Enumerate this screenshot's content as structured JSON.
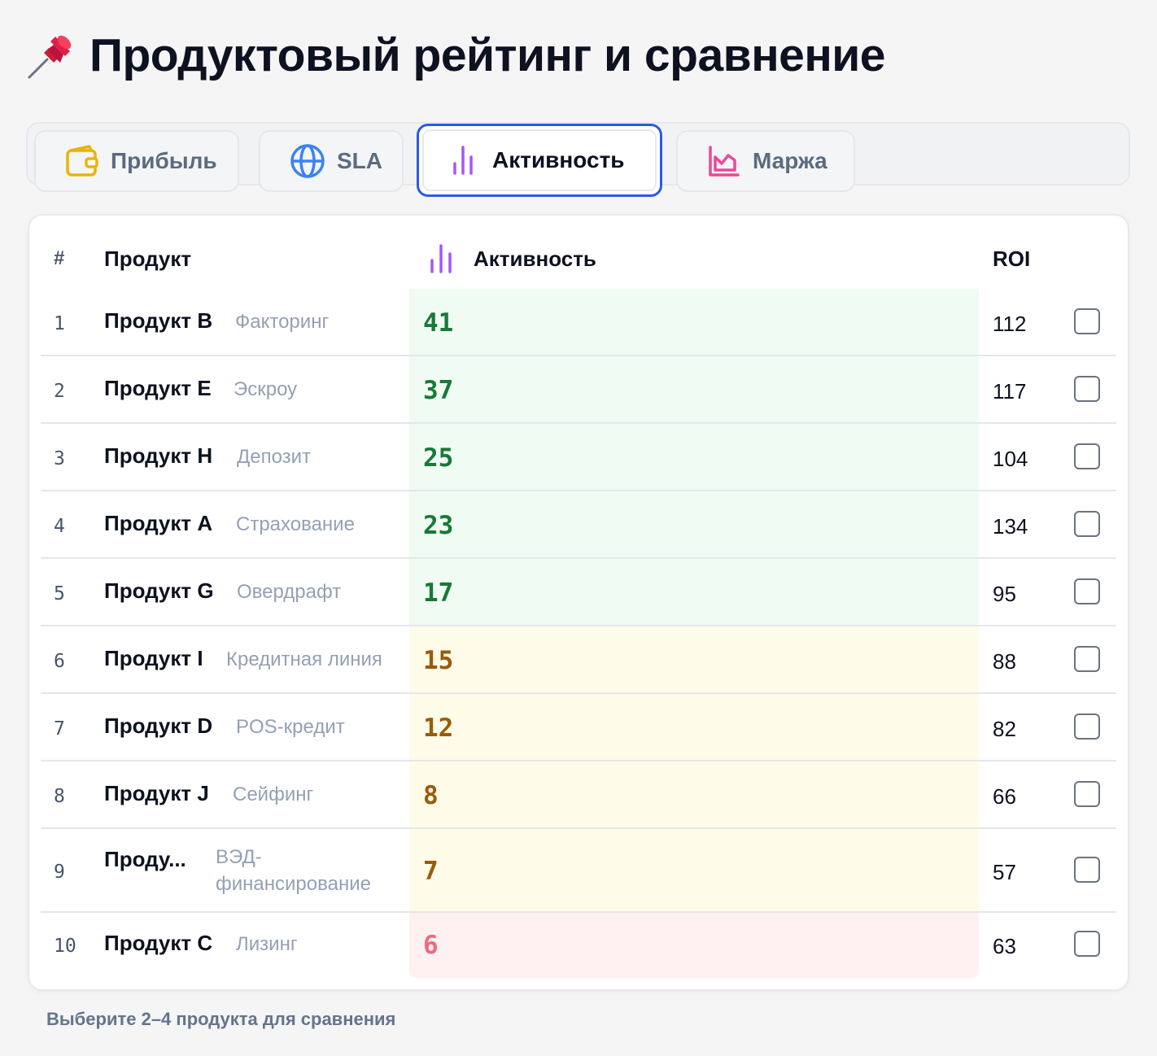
{
  "page": {
    "title": "Продуктовый рейтинг и сравнение",
    "title_icon": "pushpin-icon"
  },
  "tabs": [
    {
      "label": "Прибыль",
      "icon": "wallet-icon",
      "color": "#eab308",
      "active": false
    },
    {
      "label": "SLA",
      "icon": "globe-icon",
      "color": "#3b82f6",
      "active": false
    },
    {
      "label": "Активность",
      "icon": "bar-chart-icon",
      "color": "#a855f7",
      "active": true
    },
    {
      "label": "Маржа",
      "icon": "area-chart-icon",
      "color": "#ec4899",
      "active": false
    }
  ],
  "table": {
    "headers": {
      "num": "#",
      "product": "Продукт",
      "metric": "Активность",
      "roi": "ROI"
    },
    "rows": [
      {
        "num": "1",
        "name": "Продукт B",
        "type": "Факторинг",
        "metric": "41",
        "roi": "112",
        "level": "high"
      },
      {
        "num": "2",
        "name": "Продукт E",
        "type": "Эскроу",
        "metric": "37",
        "roi": "117",
        "level": "high"
      },
      {
        "num": "3",
        "name": "Продукт H",
        "type": "Депозит",
        "metric": "25",
        "roi": "104",
        "level": "high"
      },
      {
        "num": "4",
        "name": "Продукт A",
        "type": "Страхование",
        "metric": "23",
        "roi": "134",
        "level": "high"
      },
      {
        "num": "5",
        "name": "Продукт G",
        "type": "Овердрафт",
        "metric": "17",
        "roi": "95",
        "level": "high"
      },
      {
        "num": "6",
        "name": "Продукт I",
        "type": "Кредитная линия",
        "metric": "15",
        "roi": "88",
        "level": "mid"
      },
      {
        "num": "7",
        "name": "Продукт D",
        "type": "POS-кредит",
        "metric": "12",
        "roi": "82",
        "level": "mid"
      },
      {
        "num": "8",
        "name": "Продукт J",
        "type": "Сейфинг",
        "metric": "8",
        "roi": "66",
        "level": "mid"
      },
      {
        "num": "9",
        "name": "Проду...",
        "type": "ВЭД-\nфинансирование",
        "metric": "7",
        "roi": "57",
        "level": "mid"
      },
      {
        "num": "10",
        "name": "Продукт C",
        "type": "Лизинг",
        "metric": "6",
        "roi": "63",
        "level": "low"
      }
    ]
  },
  "colors": {
    "high_bg": "#f0fbf3",
    "high_text": "#177a35",
    "mid_bg": "#fefce8",
    "mid_text": "#9a5b0b",
    "low_bg": "#fff0f1",
    "low_text": "#ee6b7f",
    "active_tab_border": "#2b5ce0"
  },
  "footer": {
    "hint": "Выберите 2–4 продукта для сравнения"
  }
}
